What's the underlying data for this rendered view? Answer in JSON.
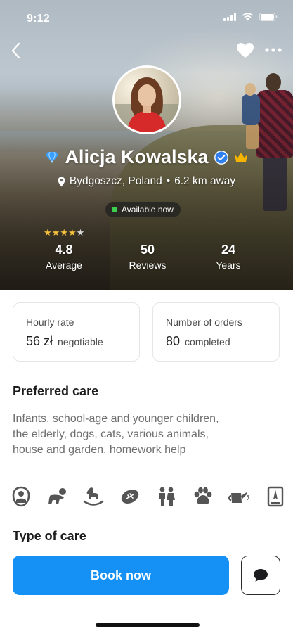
{
  "status_bar": {
    "time": "9:12"
  },
  "profile": {
    "name": "Alicja Kowalska",
    "location": "Bydgoszcz, Poland",
    "separator": "•",
    "distance": "6.2 km away",
    "availability": "Available now",
    "rating_stars": 4,
    "rating_max": 5,
    "stats": [
      {
        "value": "4.8",
        "label": "Average"
      },
      {
        "value": "50",
        "label": "Reviews"
      },
      {
        "value": "24",
        "label": "Years"
      }
    ]
  },
  "cards": {
    "hourly": {
      "caption": "Hourly rate",
      "value": "56 zł",
      "note": "negotiable"
    },
    "orders": {
      "caption": "Number of orders",
      "value": "80",
      "note": "completed"
    }
  },
  "preferred_care": {
    "title": "Preferred care",
    "description": "Infants, school-age and younger children, the elderly, dogs, cats, various animals, house and garden, homework help",
    "icons": [
      "baby-icon",
      "toddler-icon",
      "rocking-horse-icon",
      "football-icon",
      "elderly-couple-icon",
      "paw-icon",
      "watering-can-icon",
      "homework-icon"
    ]
  },
  "type_of_care": {
    "title": "Type of care"
  },
  "actions": {
    "book_label": "Book now"
  },
  "colors": {
    "accent": "#1591f5",
    "available": "#3ccf4e",
    "star": "#f6c23e",
    "verified": "#2f80ed",
    "crown": "#f5b400",
    "diamond": "#3aa0ff"
  }
}
